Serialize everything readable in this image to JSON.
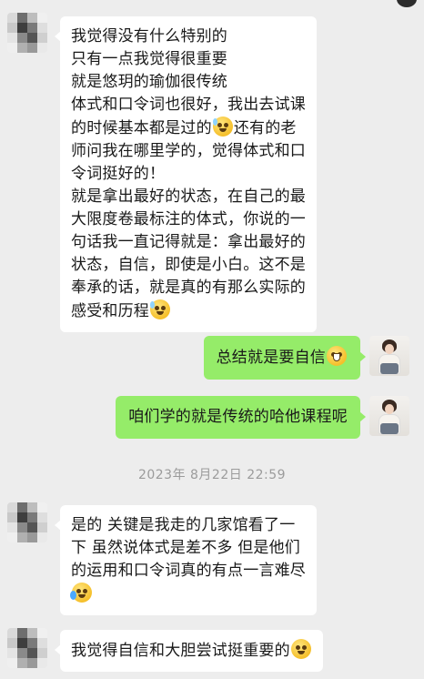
{
  "messages": [
    {
      "sender": "other",
      "lines": [
        "我觉得没有什么特别的",
        "只有一点我觉得很重要",
        "就是悠玥的瑜伽很传统",
        "体式和口令词也很好，我出去试课",
        "的时候基本都是过的",
        "还有的老",
        "师问我在哪里学的，觉得体式和口",
        "令词挺好的！",
        "就是拿出最好的状态，在自己的最",
        "大限度卷最标注的体式，你说的一",
        "句话我一直记得就是：拿出最好的",
        "状态，自信，即使是小白。这不是",
        "奉承的话，就是真的有那么实际的",
        "感受和历程"
      ],
      "emojis": [
        "sweat-smile-emoji",
        "sweat-smile-emoji"
      ]
    },
    {
      "sender": "me",
      "text": "总结就是要自信",
      "emoji": "grin-emoji"
    },
    {
      "sender": "me",
      "text": "咱们学的就是传统的哈他课程呢"
    },
    {
      "sender": "other",
      "lines": [
        "是的 关键是我走的几家馆看了一",
        "下 虽然说体式是差不多 但是他们",
        "的运用和口令词真的有点一言难尽"
      ],
      "emoji": "tears-of-joy-emoji"
    },
    {
      "sender": "other",
      "text": "我觉得自信和大胆尝试挺重要的",
      "emoji": "smile-emoji"
    }
  ],
  "timestamp": "2023年 8月22日 22:59",
  "colors": {
    "background": "#ededed",
    "incoming_bubble": "#ffffff",
    "outgoing_bubble": "#95ec69",
    "timestamp_text": "#9b9b9b"
  }
}
